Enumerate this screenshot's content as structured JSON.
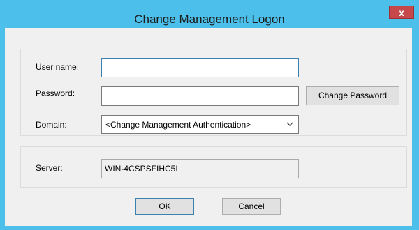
{
  "window": {
    "title": "Change Management Logon",
    "close_label": "x"
  },
  "form": {
    "username_label": "User name:",
    "username_value": "",
    "password_label": "Password:",
    "password_value": "",
    "change_password_label": "Change Password",
    "domain_label": "Domain:",
    "domain_value": "<Change Management Authentication>",
    "server_label": "Server:",
    "server_value": "WIN-4CSPSFIHC5I"
  },
  "buttons": {
    "ok_label": "OK",
    "cancel_label": "Cancel"
  },
  "colors": {
    "titlebar": "#4cc0ea",
    "close_button": "#c7484a",
    "client_background": "#f0f0f0"
  },
  "icons": {
    "dropdown": "chevron-down-icon",
    "close": "close-icon"
  }
}
